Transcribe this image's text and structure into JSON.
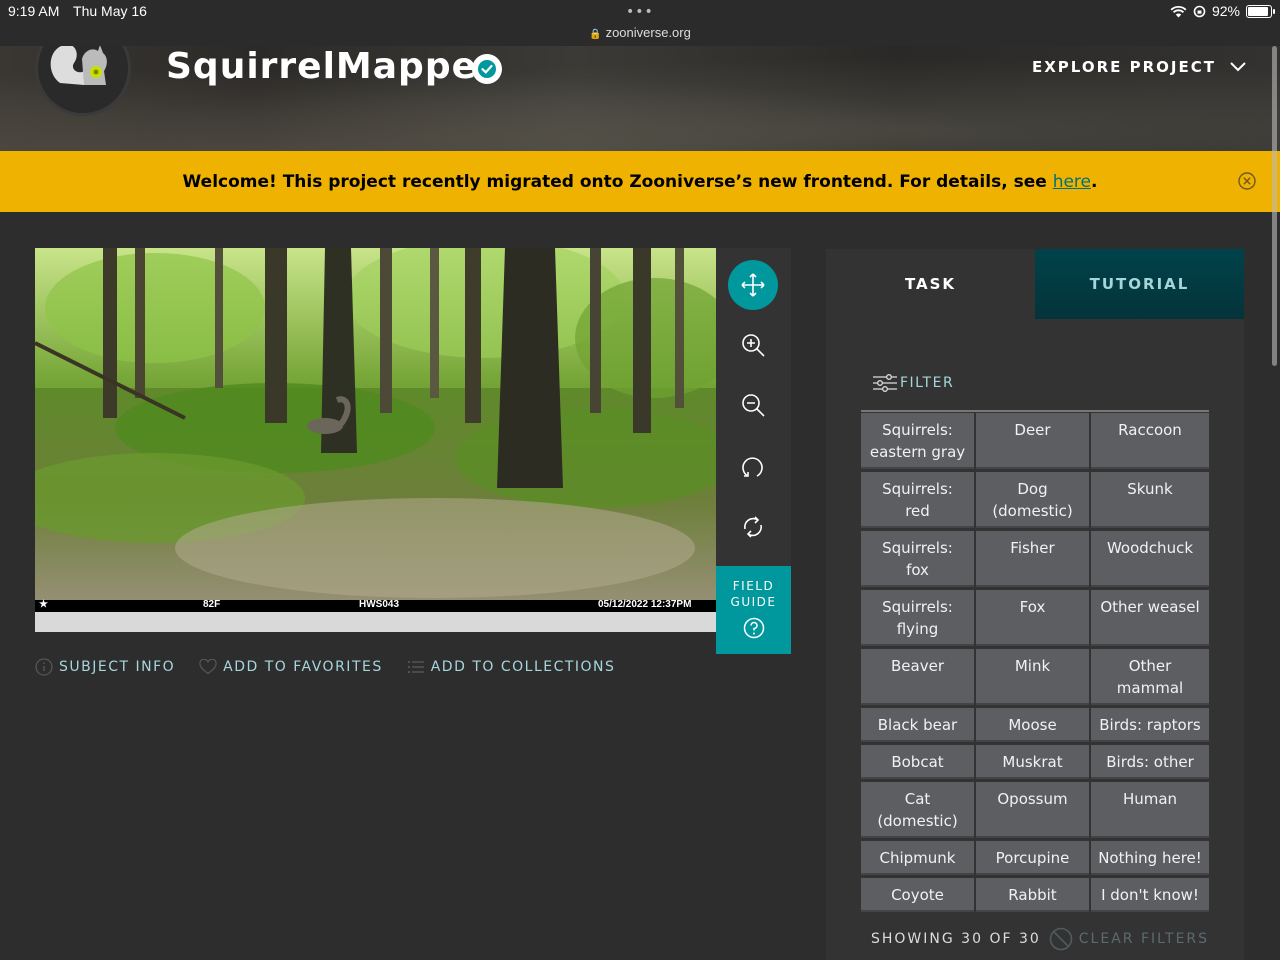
{
  "status_bar": {
    "time": "9:19 AM",
    "date": "Thu May 16",
    "dots": "•••",
    "url": "zooniverse.org",
    "battery": "92%",
    "battery_level": 0.92
  },
  "header": {
    "project_title": "SquirrelMapper",
    "explore_label": "EXPLORE PROJECT"
  },
  "banner": {
    "text": "Welcome! This project recently migrated onto Zooniverse’s new frontend. For details, see ",
    "link": "here",
    "period": "."
  },
  "subject": {
    "temperature": "82F",
    "camera_id": "HWS043",
    "timestamp": "05/12/2022 12:37PM"
  },
  "field_guide": {
    "label_line1": "FIELD",
    "label_line2": "GUIDE"
  },
  "meta_links": {
    "subject_info": "SUBJECT INFO",
    "favorites": "ADD TO FAVORITES",
    "collections": "ADD TO COLLECTIONS"
  },
  "panel": {
    "tab_task": "TASK",
    "tab_tutorial": "TUTORIAL",
    "filter_label": "FILTER",
    "choices": [
      {
        "l1": "Squirrels:",
        "l2": "eastern gray"
      },
      {
        "l1": "Deer",
        "l2": ""
      },
      {
        "l1": "Raccoon",
        "l2": ""
      },
      {
        "l1": "Squirrels:",
        "l2": "red"
      },
      {
        "l1": "Dog",
        "l2": "(domestic)"
      },
      {
        "l1": "Skunk",
        "l2": ""
      },
      {
        "l1": "Squirrels:",
        "l2": "fox"
      },
      {
        "l1": "Fisher",
        "l2": ""
      },
      {
        "l1": "Woodchuck",
        "l2": ""
      },
      {
        "l1": "Squirrels:",
        "l2": "flying"
      },
      {
        "l1": "Fox",
        "l2": ""
      },
      {
        "l1": "Other weasel",
        "l2": ""
      },
      {
        "l1": "Beaver",
        "l2": ""
      },
      {
        "l1": "Mink",
        "l2": ""
      },
      {
        "l1": "Other",
        "l2": "mammal"
      },
      {
        "l1": "Black bear",
        "l2": ""
      },
      {
        "l1": "Moose",
        "l2": ""
      },
      {
        "l1": "Birds: raptors",
        "l2": ""
      },
      {
        "l1": "Bobcat",
        "l2": ""
      },
      {
        "l1": "Muskrat",
        "l2": ""
      },
      {
        "l1": "Birds: other",
        "l2": ""
      },
      {
        "l1": "Cat",
        "l2": "(domestic)"
      },
      {
        "l1": "Opossum",
        "l2": ""
      },
      {
        "l1": "Human",
        "l2": ""
      },
      {
        "l1": "Chipmunk",
        "l2": ""
      },
      {
        "l1": "Porcupine",
        "l2": ""
      },
      {
        "l1": "Nothing here!",
        "l2": ""
      },
      {
        "l1": "Coyote",
        "l2": ""
      },
      {
        "l1": "Rabbit",
        "l2": ""
      },
      {
        "l1": "I don't know!",
        "l2": ""
      }
    ],
    "showing": "SHOWING 30 OF 30",
    "clear_filters": "CLEAR FILTERS"
  },
  "colors": {
    "accent": "#00979d",
    "banner": "#f0b200",
    "link": "#a6d6dc"
  }
}
